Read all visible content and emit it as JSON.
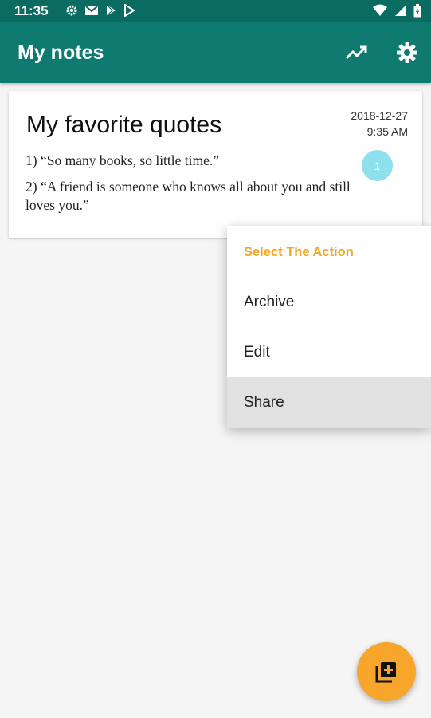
{
  "status_bar": {
    "time": "11:35",
    "icons": [
      "gear-icon",
      "gmail-icon",
      "play-store-icon",
      "play-store-icon",
      "wifi-icon",
      "signal-icon",
      "battery-icon"
    ]
  },
  "app_bar": {
    "title": "My notes",
    "actions": [
      "trending-up-icon",
      "settings-icon"
    ]
  },
  "note": {
    "title": "My favorite quotes",
    "date": "2018-12-27",
    "time": "9:35 AM",
    "lines": [
      "1) “So many books, so little time.”",
      "2) “A friend is someone who knows all about you and still loves you.”"
    ],
    "badge": "1"
  },
  "menu": {
    "title": "Select The Action",
    "items": [
      "Archive",
      "Edit",
      "Share"
    ],
    "highlighted": "Share"
  },
  "fab": {
    "icon": "add-note-icon"
  },
  "colors": {
    "primary": "#0f7b70",
    "primary_dark": "#0a6b61",
    "accent": "#f7a52b",
    "menu_title": "#f5a623",
    "badge": "#8ee0ec",
    "background": "#f5f5f5"
  }
}
